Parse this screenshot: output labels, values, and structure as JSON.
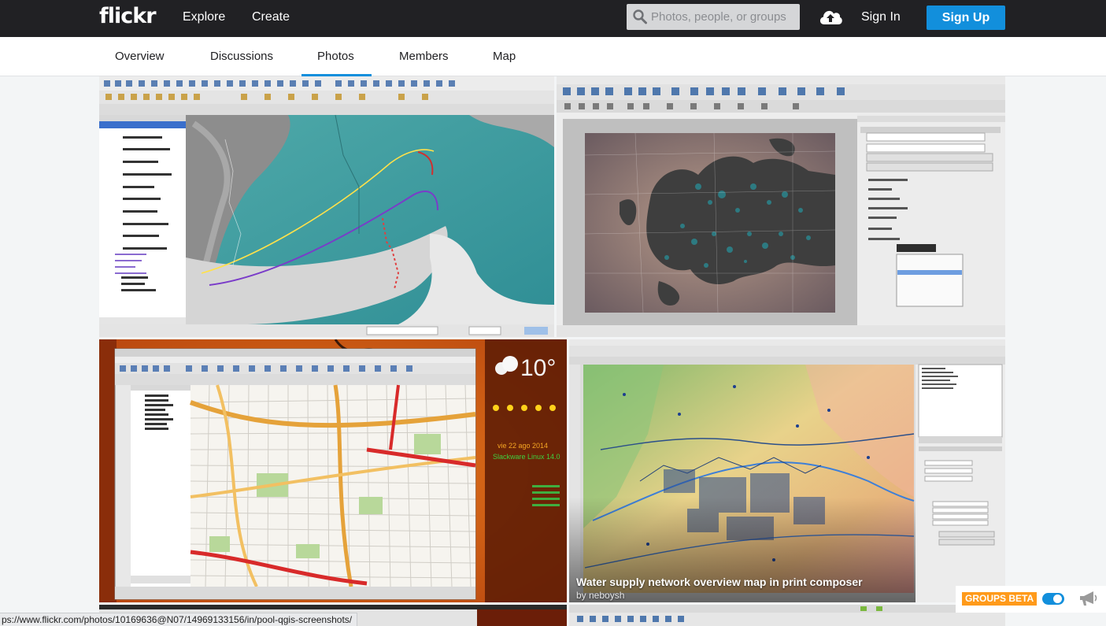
{
  "header": {
    "logo": "flickr",
    "nav": [
      "Explore",
      "Create"
    ],
    "search_placeholder": "Photos, people, or groups",
    "sign_in": "Sign In",
    "sign_up": "Sign Up"
  },
  "tabs": [
    {
      "label": "Overview",
      "active": false
    },
    {
      "label": "Discussions",
      "active": false
    },
    {
      "label": "Photos",
      "active": true
    },
    {
      "label": "Members",
      "active": false
    },
    {
      "label": "Map",
      "active": false
    }
  ],
  "photos": {
    "hover_caption": "Water supply network overview map in print composer",
    "hover_author": "by neboysh"
  },
  "status_url": "ps://www.flickr.com/photos/10169636@N07/14969133156/in/pool-qgis-screenshots/",
  "groups_widget": {
    "badge": "GROUPS BETA",
    "toggle_on": true
  },
  "colors": {
    "topbar": "#212124",
    "accent": "#128fdc",
    "badge": "#ff9a1a"
  },
  "icons": [
    "search-icon",
    "upload-cloud-icon",
    "megaphone-icon"
  ]
}
